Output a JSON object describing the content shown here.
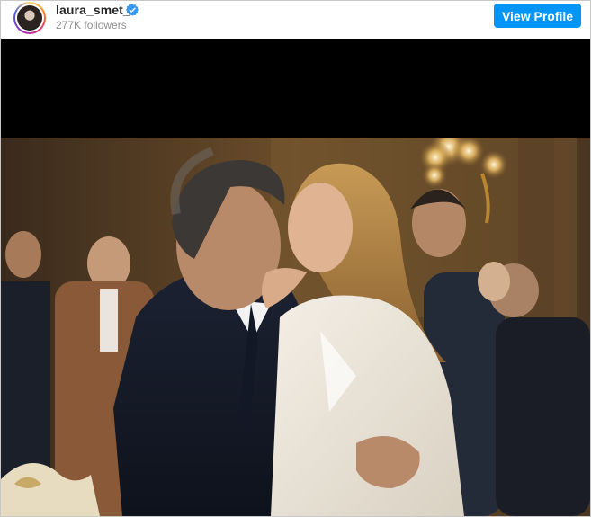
{
  "profile": {
    "username": "laura_smet_",
    "followers": "277K followers",
    "verified": true,
    "view_profile_label": "View Profile"
  },
  "colors": {
    "button_bg": "#0095f6",
    "verified_badge": "#3897f0",
    "username": "#262626",
    "followers": "#8e8e8e"
  },
  "icons": {
    "verified": "verified-badge-icon"
  },
  "post": {
    "photo": "wedding-kiss-photo"
  }
}
